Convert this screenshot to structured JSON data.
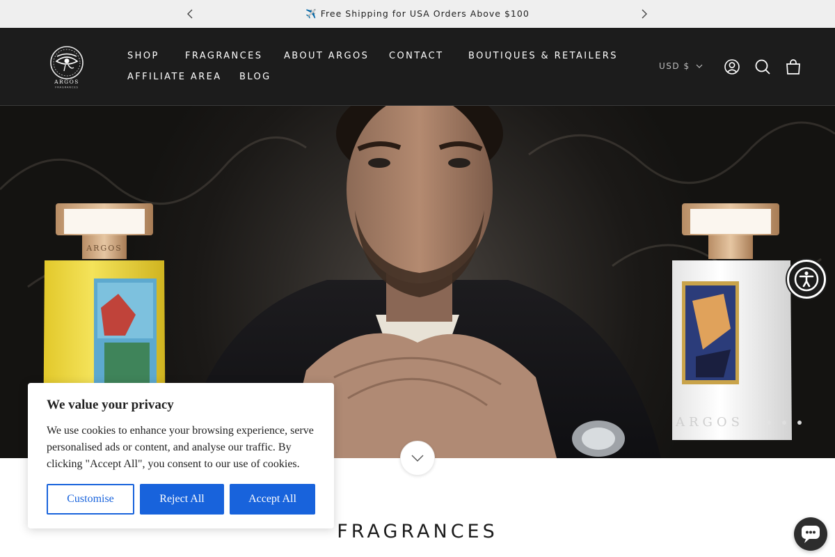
{
  "announcement": {
    "icon": "airplane-icon",
    "text": "✈️ Free Shipping for USA Orders Above $100"
  },
  "header": {
    "logo_text": "ARGOS",
    "logo_subtext": "FRAGRANCES",
    "nav": [
      "SHOP",
      "FRAGRANCES",
      "ABOUT ARGOS",
      "CONTACT",
      "BOUTIQUES & RETAILERS",
      "AFFILIATE AREA",
      "BLOG"
    ],
    "currency": "USD $",
    "icons": [
      "account-icon",
      "search-icon",
      "cart-icon"
    ]
  },
  "hero": {
    "left_bottle_label": "ARGOS",
    "right_bottle_label": "ARGOS",
    "slides_total": 3,
    "active_slide": 3
  },
  "cookie": {
    "title": "We value your privacy",
    "text": "We use cookies to enhance your browsing experience, serve personalised ads or content, and analyse our traffic. By clicking \"Accept All\", you consent to our use of cookies.",
    "customise": "Customise",
    "reject": "Reject All",
    "accept": "Accept All"
  },
  "section": {
    "title": "FRAGRANCES"
  },
  "colors": {
    "header_bg": "#1c1c1c",
    "announce_bg": "#efefef",
    "cookie_button": "#1863dc",
    "bottle_gold": "#d9b38c",
    "bottle_yellow": "#f0de3a"
  }
}
